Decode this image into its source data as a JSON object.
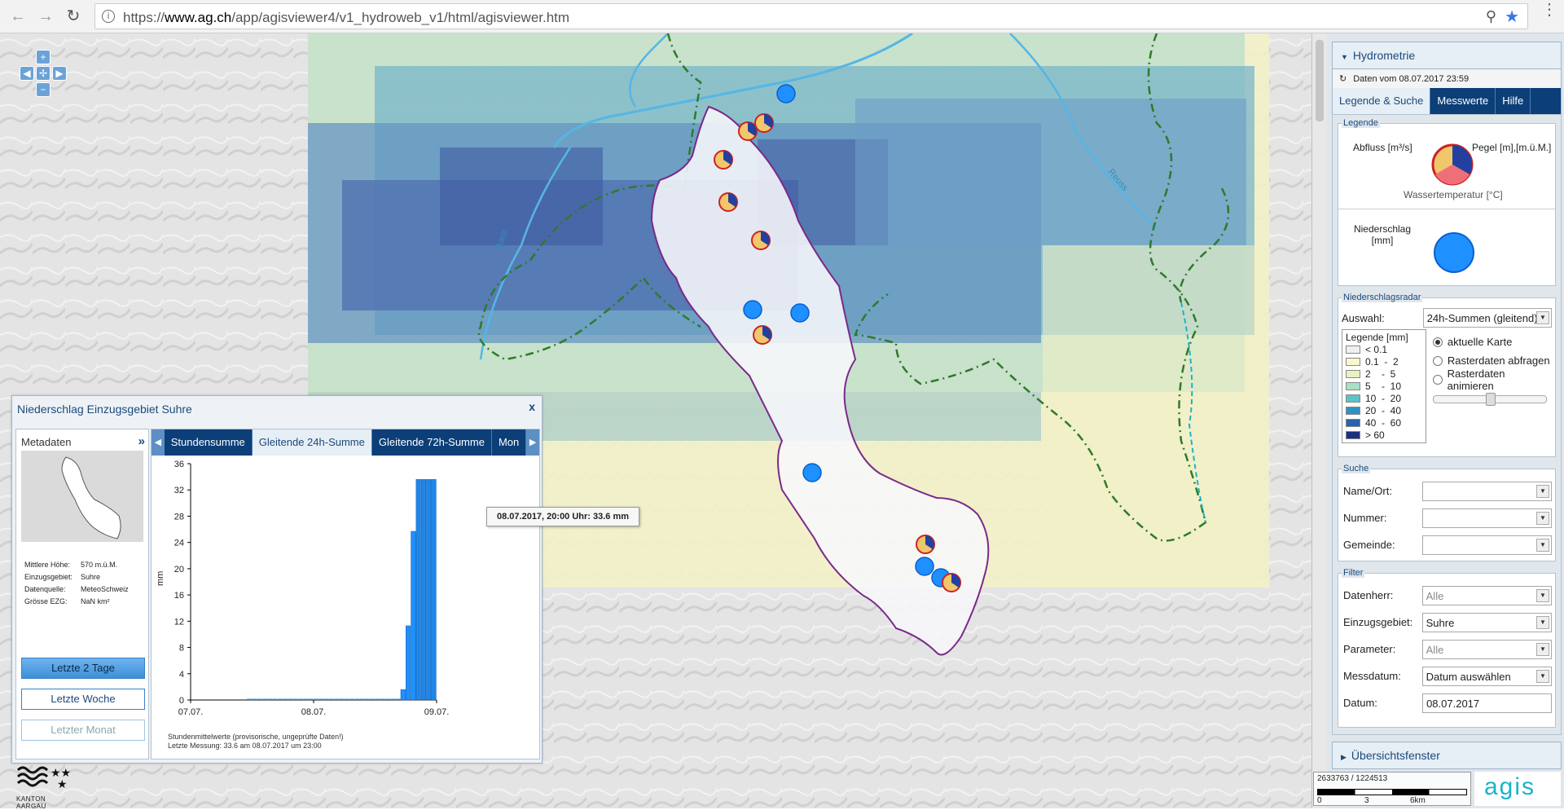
{
  "browser": {
    "url_prefix": "https://",
    "url_host": "www.ag.ch",
    "url_path": "/app/agisviewer4/v1_hydroweb_v1/html/agisviewer.htm"
  },
  "map_labels": {
    "aare": "Aare",
    "reuss": "Reuss"
  },
  "panel": {
    "title": "Hydrometrie",
    "data_date": "Daten vom 08.07.2017 23:59",
    "tabs": [
      "Legende & Suche",
      "Messwerte",
      "Hilfe"
    ],
    "legende": {
      "legend_title": "Legende",
      "abfluss": "Abfluss [m³/s]",
      "pegel": "Pegel [m],[m.ü.M.]",
      "wassertemp": "Wassertemperatur [°C]",
      "niederschlag": "Niederschlag [mm]"
    },
    "radar": {
      "title": "Niederschlagsradar",
      "auswahl_label": "Auswahl:",
      "auswahl_value": "24h-Summen (gleitend)",
      "legend_title": "Legende [mm]",
      "classes": [
        {
          "range": "< 0.1",
          "color": "#f0f0f0"
        },
        {
          "range": "0.1  -  2",
          "color": "#fbf7cc"
        },
        {
          "range": "2    -  5",
          "color": "#e8f1c0"
        },
        {
          "range": "5    -  10",
          "color": "#a9dfc4"
        },
        {
          "range": "10  -  20",
          "color": "#59c3c8"
        },
        {
          "range": "20  -  40",
          "color": "#2c93c4"
        },
        {
          "range": "40  -  60",
          "color": "#2a63a8"
        },
        {
          "range": "> 60",
          "color": "#1b2f7f"
        }
      ],
      "radio": [
        "aktuelle Karte",
        "Rasterdaten abfragen",
        "Rasterdaten animieren"
      ]
    },
    "suche": {
      "title": "Suche",
      "fields": [
        "Name/Ort:",
        "Nummer:",
        "Gemeinde:"
      ]
    },
    "filter": {
      "title": "Filter",
      "rows": [
        {
          "label": "Datenherr:",
          "value": "Alle",
          "grey": true
        },
        {
          "label": "Einzugsgebiet:",
          "value": "Suhre",
          "grey": false
        },
        {
          "label": "Parameter:",
          "value": "Alle",
          "grey": true
        },
        {
          "label": "Messdatum:",
          "value": "Datum auswählen",
          "grey": false
        }
      ],
      "datum_label": "Datum:",
      "datum_value": "08.07.2017"
    },
    "uebersicht": "Übersichtsfenster"
  },
  "popup": {
    "title": "Niederschlag Einzugsgebiet Suhre",
    "close": "x",
    "metadaten": "Metadaten",
    "meta": [
      {
        "k": "Mittlere Höhe:",
        "v": "570 m.ü.M."
      },
      {
        "k": "Einzugsgebiet:",
        "v": "Suhre"
      },
      {
        "k": "Datenquelle:",
        "v": "MeteoSchweiz"
      },
      {
        "k": "Grösse EZG:",
        "v": "NaN km²"
      }
    ],
    "buttons": [
      "Letzte 2 Tage",
      "Letzte Woche",
      "Letzter Monat"
    ],
    "tabs": [
      "Stundensumme",
      "Gleitende 24h-Summe",
      "Gleitende 72h-Summe",
      "Mon"
    ],
    "footnote1": "Stundenmittelwerte (provisorische, ungeprüfte Daten!)",
    "footnote2": "Letzte Messung: 33.6 am 08.07.2017 um 23:00",
    "tooltip": "08.07.2017, 20:00 Uhr: 33.6 mm"
  },
  "chart_data": {
    "type": "bar",
    "ylabel": "mm",
    "ylim": [
      0,
      36
    ],
    "yticks": [
      0,
      4,
      8,
      12,
      16,
      20,
      24,
      28,
      32,
      36
    ],
    "xticks": [
      "07.07.",
      "08.07.",
      "09.07."
    ],
    "bars": [
      {
        "hour": 41,
        "value": 1.6
      },
      {
        "hour": 42,
        "value": 11.3
      },
      {
        "hour": 43,
        "value": 25.7
      },
      {
        "hour": 44,
        "value": 33.6
      },
      {
        "hour": 45,
        "value": 33.6
      },
      {
        "hour": 46,
        "value": 33.6
      },
      {
        "hour": 47,
        "value": 33.6
      }
    ],
    "near_zero_range": [
      11,
      40
    ]
  },
  "footer": {
    "kanton": "KANTON AARGAU",
    "coords": "2633763 / 1224513",
    "scale_ticks": [
      "0",
      "3",
      "6km"
    ],
    "logo": "agis"
  }
}
